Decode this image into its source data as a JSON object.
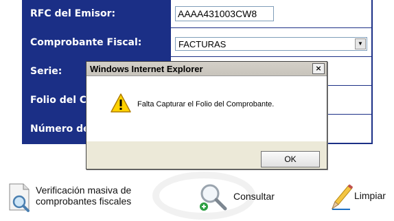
{
  "form": {
    "rfc_label": "RFC del Emisor:",
    "rfc_value": "AAAA431003CW8",
    "comprobante_label": "Comprobante Fiscal:",
    "comprobante_value": "FACTURAS",
    "serie_label": "Serie:",
    "folio_label": "Folio del Co",
    "numero_label": "Número de"
  },
  "actions": {
    "verificacion_line1": "Verificación masiva de",
    "verificacion_line2": "comprobantes fiscales",
    "consultar": "Consultar",
    "limpiar": "Limpiar"
  },
  "dialog": {
    "title": "Windows Internet Explorer",
    "message": "Falta Capturar el Folio del Comprobante.",
    "ok_label": "OK",
    "close_glyph": "×"
  },
  "colors": {
    "label_bg": "#1b2f86",
    "dialog_bg": "#ece9d8"
  },
  "icons": [
    "warning-icon",
    "document-search-icon",
    "magnifier-icon",
    "pencil-icon",
    "close-icon",
    "chevron-down-icon"
  ]
}
